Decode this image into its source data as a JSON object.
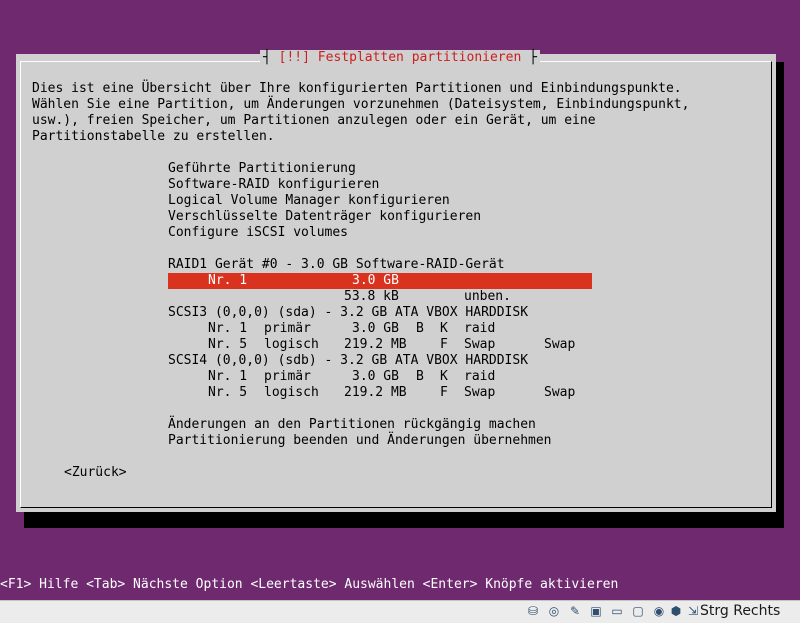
{
  "dialog": {
    "title": "[!!] Festplatten partitionieren",
    "title_left_bar": "┤",
    "title_right_bar": "├",
    "intro_lines": [
      "Dies ist eine Übersicht über Ihre konfigurierten Partitionen und Einbindungspunkte.",
      "Wählen Sie eine Partition, um Änderungen vorzunehmen (Dateisystem, Einbindungspunkt,",
      "usw.), freien Speicher, um Partitionen anzulegen oder ein Gerät, um eine",
      "Partitionstabelle zu erstellen."
    ],
    "menu_actions": [
      "Geführte Partitionierung",
      "Software-RAID konfigurieren",
      "Logical Volume Manager konfigurieren",
      "Verschlüsselte Datenträger konfigurieren",
      "Configure iSCSI volumes"
    ],
    "raid_device": "RAID1 Gerät #0 - 3.0 GB Software-RAID-Gerät",
    "raid_partition": {
      "num": "Nr. 1",
      "size": "3.0 GB"
    },
    "raid_free": {
      "size": "53.8 kB",
      "type": "unben."
    },
    "disk1": {
      "header": "SCSI3 (0,0,0) (sda) - 3.2 GB ATA VBOX HARDDISK",
      "partitions": [
        {
          "num": "Nr. 1",
          "kind": "primär",
          "size": "3.0 GB",
          "flag1": "B",
          "flag2": "K",
          "fs": "raid",
          "mount": ""
        },
        {
          "num": "Nr. 5",
          "kind": "logisch",
          "size": "219.2 MB",
          "flag1": "",
          "flag2": "F",
          "fs": "Swap",
          "mount": "Swap"
        }
      ]
    },
    "disk2": {
      "header": "SCSI4 (0,0,0) (sdb) - 3.2 GB ATA VBOX HARDDISK",
      "partitions": [
        {
          "num": "Nr. 1",
          "kind": "primär",
          "size": "3.0 GB",
          "flag1": "B",
          "flag2": "K",
          "fs": "raid",
          "mount": ""
        },
        {
          "num": "Nr. 5",
          "kind": "logisch",
          "size": "219.2 MB",
          "flag1": "",
          "flag2": "F",
          "fs": "Swap",
          "mount": "Swap"
        }
      ]
    },
    "menu_final": [
      "Änderungen an den Partitionen rückgängig machen",
      "Partitionierung beenden und Änderungen übernehmen"
    ],
    "back_button": "<Zurück>"
  },
  "hint_bar": "<F1> Hilfe <Tab> Nächste Option <Leertaste> Auswählen <Enter> Knöpfe aktivieren",
  "statusbar": {
    "icons": [
      "hard-disk-icon",
      "optical-disk-icon",
      "usb-icon",
      "network-icon",
      "shared-folder-icon",
      "display-icon",
      "video-capture-icon",
      "guest-additions-icon",
      "mouse-integration-icon"
    ],
    "host_key": "Strg Rechts"
  },
  "colors": {
    "background": "#6f2a6f",
    "dialog": "#d0d0d0",
    "title": "#cc1f1f",
    "selection": "#d9321f"
  }
}
